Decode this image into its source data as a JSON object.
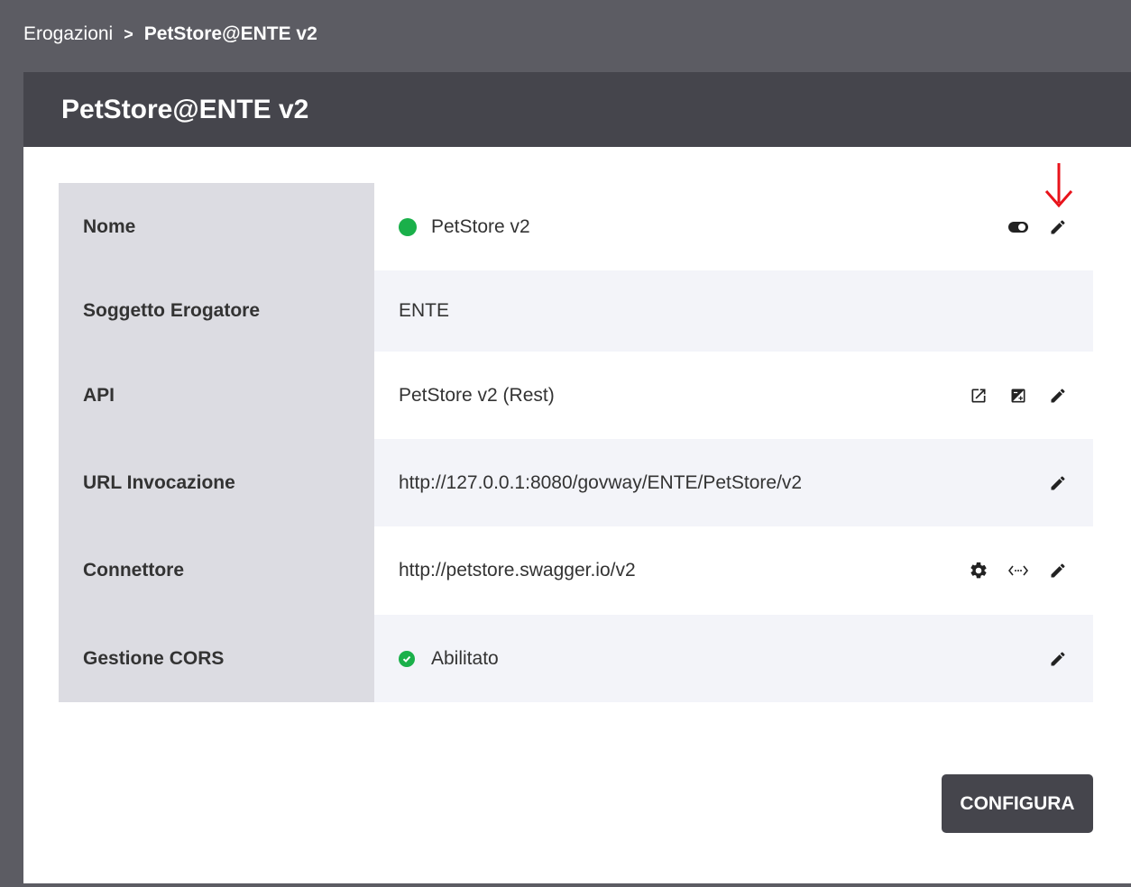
{
  "breadcrumb": {
    "root": "Erogazioni",
    "separator": ">",
    "current": "PetStore@ENTE v2"
  },
  "header": {
    "title": "PetStore@ENTE v2"
  },
  "rows": [
    {
      "label": "Nome",
      "value": "PetStore v2",
      "status": "active",
      "icons": [
        "toggle-icon",
        "edit-icon"
      ]
    },
    {
      "label": "Soggetto Erogatore",
      "value": "ENTE",
      "icons": []
    },
    {
      "label": "API",
      "value": "PetStore v2 (Rest)",
      "icons": [
        "open-external-icon",
        "add-subtract-icon",
        "edit-icon"
      ]
    },
    {
      "label": "URL Invocazione",
      "value": "http://127.0.0.1:8080/govway/ENTE/PetStore/v2",
      "icons": [
        "edit-icon"
      ]
    },
    {
      "label": "Connettore",
      "value": "http://petstore.swagger.io/v2",
      "icons": [
        "gear-icon",
        "code-arrows-icon",
        "edit-icon"
      ]
    },
    {
      "label": "Gestione CORS",
      "value": "Abilitato",
      "status": "enabled",
      "icons": [
        "edit-icon"
      ]
    }
  ],
  "actions": {
    "configure_label": "CONFIGURA"
  },
  "colors": {
    "header_bg": "#45454c",
    "status_green": "#1ab04a",
    "annotation_red": "#e8131b"
  }
}
